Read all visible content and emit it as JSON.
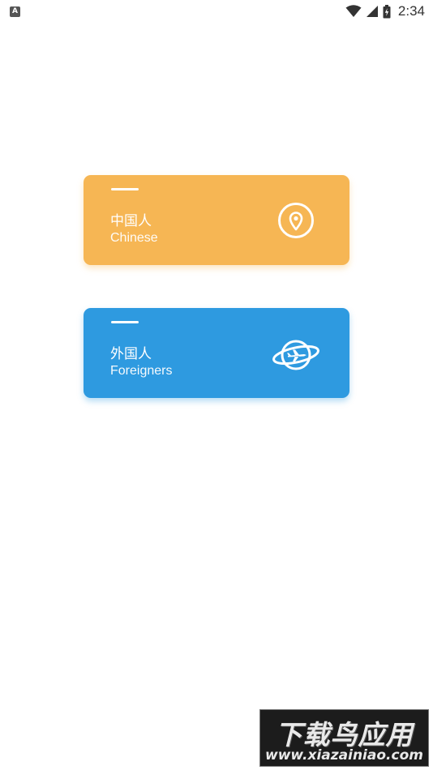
{
  "status_bar": {
    "notification_letter": "A",
    "time": "2:34",
    "icons": [
      "wifi-icon",
      "cell-signal-icon",
      "battery-charging-icon"
    ]
  },
  "cards": [
    {
      "icon": "location-pin-icon",
      "label_zh": "中国人",
      "label_en": "Chinese",
      "color": "#f6b654"
    },
    {
      "icon": "planet-airplane-icon",
      "label_zh": "外国人",
      "label_en": "Foreigners",
      "color": "#2e9ae0"
    }
  ],
  "watermark": {
    "title": "下载鸟应用",
    "url": "www.xiazainiao.com"
  }
}
